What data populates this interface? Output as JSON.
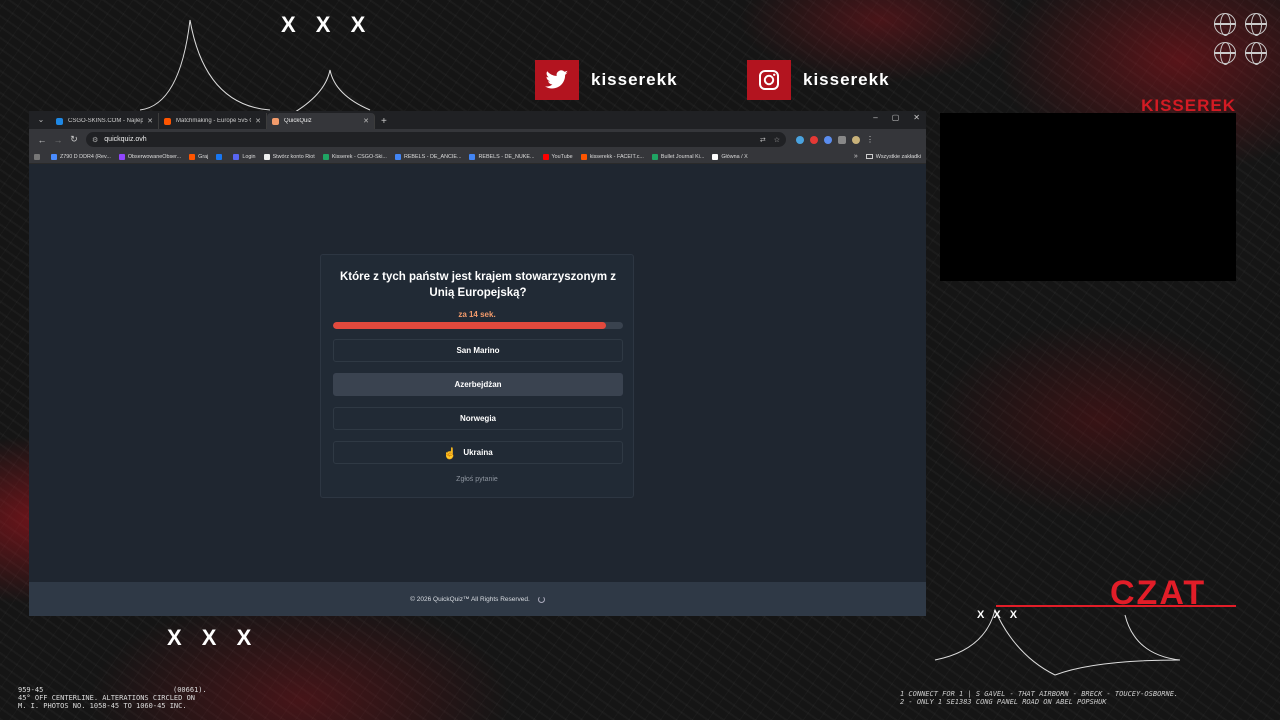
{
  "overlay": {
    "x_marks_top": "X X X",
    "x_marks_bottom": "X X X",
    "x_marks_chat": "X X X",
    "twitter_handle": "kisserekk",
    "instagram_handle": "kisserekk",
    "brand_name": "KISSEREK",
    "chat_label": "CZAT",
    "film_text_left": "959-45\n45° OFF CENTERLINE. ALTERATIONS CIRCLED ON\nM. I. PHOTOS NO. 1058-45 TO 1060-45 INC.",
    "film_text_left_code": "(00661).",
    "film_text_right": "1 CONNECT FOR 1 | S GAVEL - THAT AIRBORN - BRECK - TOUCEY-OSBORNE.\n2 - ONLY 1 SE1383 CONG PANEL ROAD ON ABEL POPSHUK",
    "accent_color": "#d41a23"
  },
  "browser": {
    "tabs": [
      {
        "title": "CSGO-SKINS.COM - Najlepsze",
        "favicon_color": "#1e88e5",
        "active": false
      },
      {
        "title": "Matchmaking - Europe 5v5 Qu",
        "favicon_color": "#ff5500",
        "active": false
      },
      {
        "title": "QuickQuiz",
        "favicon_color": "#f39b6b",
        "active": true
      }
    ],
    "new_tab_symbol": "+",
    "window_controls": [
      "–",
      "▢",
      "✕"
    ],
    "url": "quickquiz.ovh",
    "bookmarks": [
      {
        "label": "Z790 D DDR4 (Rev...",
        "color": "#4a8cff"
      },
      {
        "label": "ObserwowaneObser...",
        "color": "#9146ff"
      },
      {
        "label": "Graj",
        "color": "#ff5500"
      },
      {
        "label": "",
        "color": "#1877f2"
      },
      {
        "label": "Login",
        "color": "#5865f2"
      },
      {
        "label": "Stwórz konto Riot",
        "color": "#eeeeee"
      },
      {
        "label": "Kisserek - CSGO-Ski...",
        "color": "#1fa463"
      },
      {
        "label": "REBELS - DE_ANCIE...",
        "color": "#4285f4"
      },
      {
        "label": "REBELS - DE_NUKE...",
        "color": "#4285f4"
      },
      {
        "label": "YouTube",
        "color": "#ff0000"
      },
      {
        "label": "kisserekk - FACEIT.c...",
        "color": "#ff5500"
      },
      {
        "label": "Bullet Journal Ki...",
        "color": "#1fa463"
      },
      {
        "label": "Główna / X",
        "color": "#ffffff"
      }
    ],
    "bookmarks_more": "»",
    "all_bookmarks_label": "Wszystkie zakładki"
  },
  "quiz": {
    "question": "Które z tych państw jest krajem stowarzyszonym z Unią Europejską?",
    "timer_text": "za 14 sek.",
    "progress_fraction": 0.94,
    "answers": [
      "San Marino",
      "Azerbejdżan",
      "Norwegia",
      "Ukraina"
    ],
    "hovered_answer": "Azerbejdżan",
    "report_label": "Zgłoś pytanie",
    "footer_text": "© 2026  QuickQuiz™ All Rights Reserved."
  }
}
